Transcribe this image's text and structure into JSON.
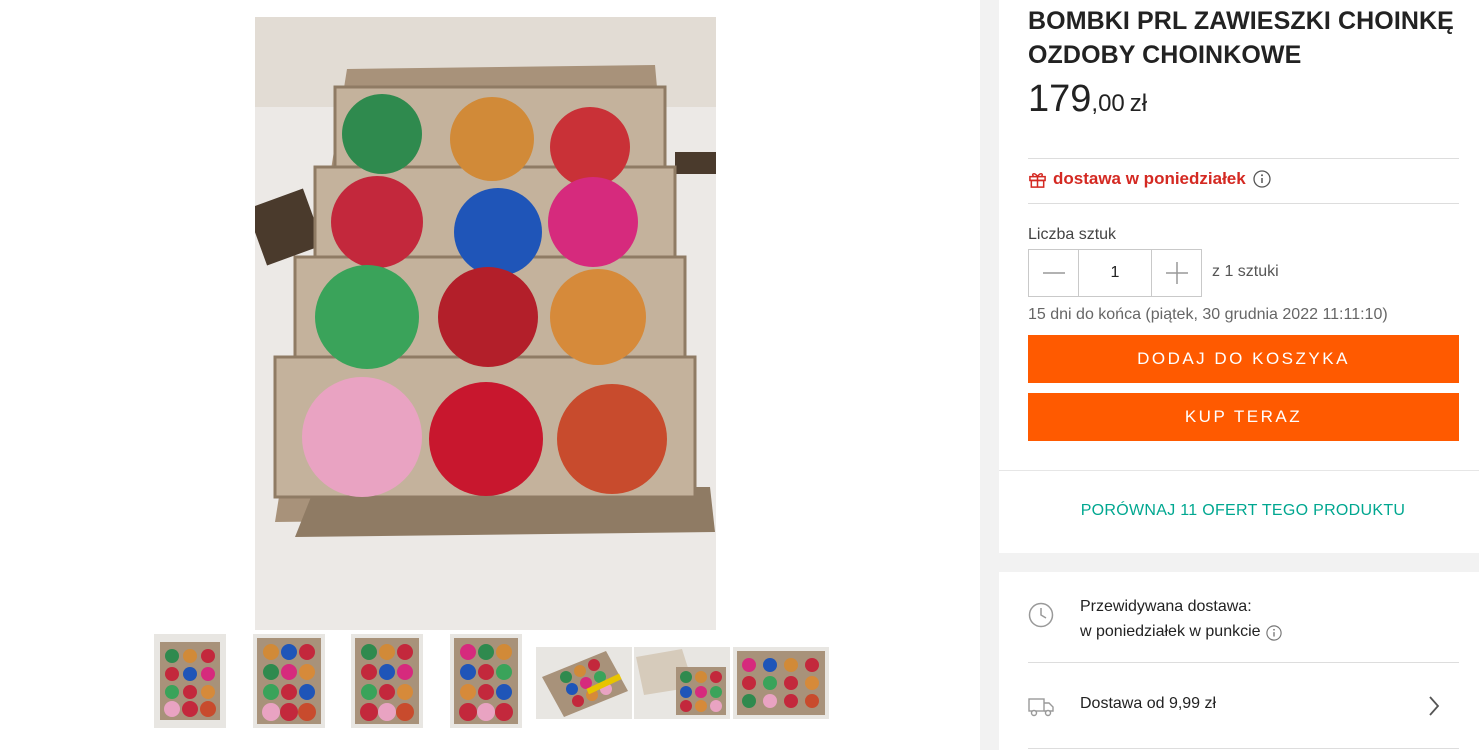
{
  "product": {
    "title": "BOMBKI PRL ZAWIESZKI CHOINKĘ OZDOBY CHOINKOWE",
    "price_int": "179",
    "price_dec": ",00",
    "currency": "zł"
  },
  "delivery_badge": {
    "text": "dostawa w poniedziałek",
    "icon": "gift-icon",
    "color": "#d42922"
  },
  "quantity": {
    "label": "Liczba sztuk",
    "value": "1",
    "of_text": "z 1 sztuki"
  },
  "offer_end": "15 dni do końca (piątek, 30 grudnia 2022 11:11:10)",
  "buttons": {
    "add_to_cart": "DODAJ DO KOSZYKA",
    "buy_now": "KUP TERAZ",
    "compare": "PORÓWNAJ 11 OFERT TEGO PRODUKTU",
    "accent": "#ff5a00",
    "compare_color": "#00a790"
  },
  "shipping": {
    "expected_label": "Przewidywana dostawa:",
    "expected_value": "w poniedziałek w punkcie",
    "delivery_from": "Dostawa od 9,99 zł"
  },
  "gallery": {
    "thumbnail_count": 7,
    "icons": [
      "clock-icon",
      "truck-icon",
      "chevron-right-icon",
      "info-icon",
      "minus-icon",
      "plus-icon"
    ]
  }
}
